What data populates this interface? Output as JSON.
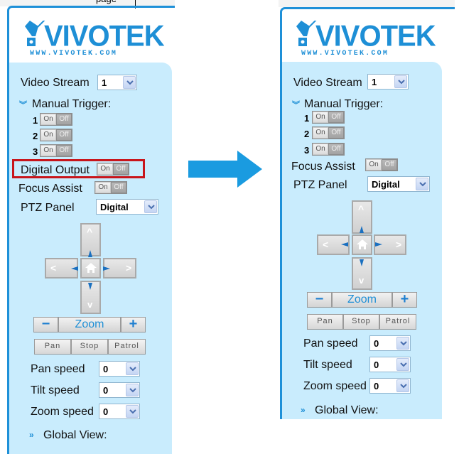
{
  "header_clip": {
    "text": "page"
  },
  "arrow": {
    "color": "#1a9be0",
    "meaning": "before-after"
  },
  "colors": {
    "accent": "#1e90d8",
    "panel_bg": "#c9ecfd",
    "highlight": "#c8151b"
  },
  "panels": [
    {
      "id": "before",
      "logo": {
        "brand": "VIVOTEK",
        "url": "WWW.VIVOTEK.COM"
      },
      "video_stream": {
        "label": "Video Stream",
        "value": "1"
      },
      "manual_trigger": {
        "label": "Manual Trigger:",
        "icon": "chevron-double-down-icon",
        "items": [
          {
            "num": "1",
            "on": "On",
            "off": "Off"
          },
          {
            "num": "2",
            "on": "On",
            "off": "Off"
          },
          {
            "num": "3",
            "on": "On",
            "off": "Off"
          }
        ]
      },
      "digital_output": {
        "label": "Digital Output",
        "on": "On",
        "off": "Off",
        "highlighted": true
      },
      "focus_assist": {
        "label": "Focus Assist",
        "on": "On",
        "off": "Off"
      },
      "ptz_panel": {
        "label": "PTZ Panel",
        "value": "Digital"
      },
      "zoom": {
        "minus": "−",
        "label": "Zoom",
        "plus": "+"
      },
      "actions": {
        "pan": "Pan",
        "stop": "Stop",
        "patrol": "Patrol"
      },
      "pan_speed": {
        "label": "Pan speed",
        "value": "0"
      },
      "tilt_speed": {
        "label": "Tilt speed",
        "value": "0"
      },
      "zoom_speed": {
        "label": "Zoom speed",
        "value": "0"
      },
      "global_view": {
        "label": "Global View:",
        "icon": "chevron-double-right-icon"
      }
    },
    {
      "id": "after",
      "logo": {
        "brand": "VIVOTEK",
        "url": "WWW.VIVOTEK.COM"
      },
      "video_stream": {
        "label": "Video Stream",
        "value": "1"
      },
      "manual_trigger": {
        "label": "Manual Trigger:",
        "icon": "chevron-double-down-icon",
        "items": [
          {
            "num": "1",
            "on": "On",
            "off": "Off"
          },
          {
            "num": "2",
            "on": "On",
            "off": "Off"
          },
          {
            "num": "3",
            "on": "On",
            "off": "Off"
          }
        ]
      },
      "focus_assist": {
        "label": "Focus Assist",
        "on": "On",
        "off": "Off"
      },
      "ptz_panel": {
        "label": "PTZ Panel",
        "value": "Digital"
      },
      "zoom": {
        "minus": "−",
        "label": "Zoom",
        "plus": "+"
      },
      "actions": {
        "pan": "Pan",
        "stop": "Stop",
        "patrol": "Patrol"
      },
      "pan_speed": {
        "label": "Pan speed",
        "value": "0"
      },
      "tilt_speed": {
        "label": "Tilt speed",
        "value": "0"
      },
      "zoom_speed": {
        "label": "Zoom speed",
        "value": "0"
      },
      "global_view": {
        "label": "Global View:",
        "icon": "chevron-double-right-icon"
      }
    }
  ]
}
